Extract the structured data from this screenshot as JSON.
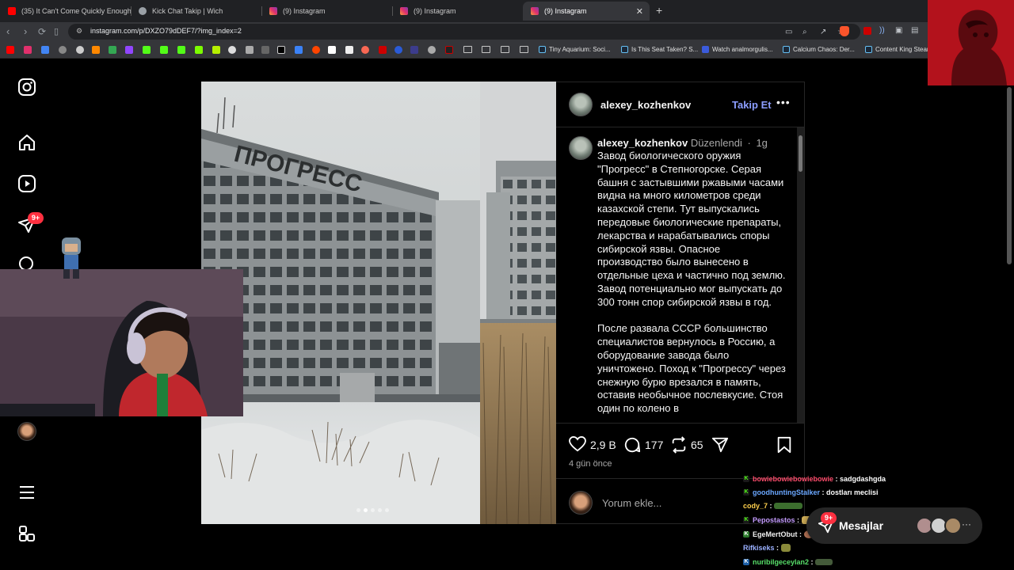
{
  "browser": {
    "tabs": [
      {
        "title": "(35) It Can't Come Quickly Enough -",
        "fav": "#ff0000"
      },
      {
        "title": "Kick Chat Takip | Wich",
        "fav": "#9aa0a6"
      },
      {
        "title": "(9) Instagram",
        "fav": "#e1306c"
      },
      {
        "title": "(9) Instagram",
        "fav": "#e1306c"
      },
      {
        "title": "(9) Instagram",
        "fav": "#e1306c"
      }
    ],
    "url": "instagram.com/p/DXZO79dDEF7/?img_index=2",
    "bookmarks": [
      "Tiny Aquarium: Soci...",
      "Is This Seat Taken? S...",
      "Watch analmorgulis...",
      "Calcium Chaos: Der...",
      "Content King Stear"
    ]
  },
  "rail": {
    "notif_badge": "9+"
  },
  "post": {
    "username": "alexey_kozhenkov",
    "follow_label": "Takip Et",
    "edited_label": "Düzenlendi",
    "age": "1g",
    "caption_paragraphs": [
      "Завод биологического оружия \"Прогресс\" в Степногорске. Серая башня с застывшими ржавыми часами видна на много километров среди казахской степи. Тут выпускались передовые биологические препараты, лекарства и нарабатывались споры сибирской язвы. Опасное производство было вынесено в отдельные цеха и частично под землю. Завод потенциально мог выпускать до 300 тонн спор сибирской язвы в год.",
      "После развала СССР большинство специалистов вернулось в Россию, а оборудование завода было уничтожено. Поход к \"Прогрессу\" через снежную бурю врезался в память, оставив необычное послевкусие. Стоя один по колено в"
    ],
    "building_sign": "ПРОГРЕСС",
    "likes": "2,9 B",
    "comments": "177",
    "reposts": "65",
    "posted_ago": "4 gün önce",
    "comment_placeholder": "Yorum ekle..."
  },
  "messages": {
    "label": "Mesajlar",
    "badge": "9+"
  },
  "chat": [
    {
      "user": "bowiebowiebowiebowie",
      "text": "sadgdashgda",
      "color": "#ff4d6d",
      "badge": "K",
      "badge_color": "#1a1a1a"
    },
    {
      "user": "goodhuntingStalker",
      "text": "dostları meclisi",
      "color": "#6aa7ff",
      "badge": "K",
      "badge_color": "#1a1a1a"
    },
    {
      "user": "cody_7",
      "text": "",
      "color": "#ffd04d",
      "badge": "",
      "badge_color": ""
    },
    {
      "user": "Pepostastos",
      "text": "",
      "color": "#c59cff",
      "badge": "K",
      "badge_color": "#1a1a1a"
    },
    {
      "user": "EgeMertObut",
      "text": "",
      "color": "#f0f0f0",
      "badge": "K",
      "badge_color": "#2c7a2c"
    },
    {
      "user": "Rifkiseks",
      "text": "",
      "color": "#9ab0ff",
      "badge": "",
      "badge_color": ""
    },
    {
      "user": "nuribilgeceylan2",
      "text": "",
      "color": "#58e06a",
      "badge": "K",
      "badge_color": "#1d5fa6"
    }
  ]
}
